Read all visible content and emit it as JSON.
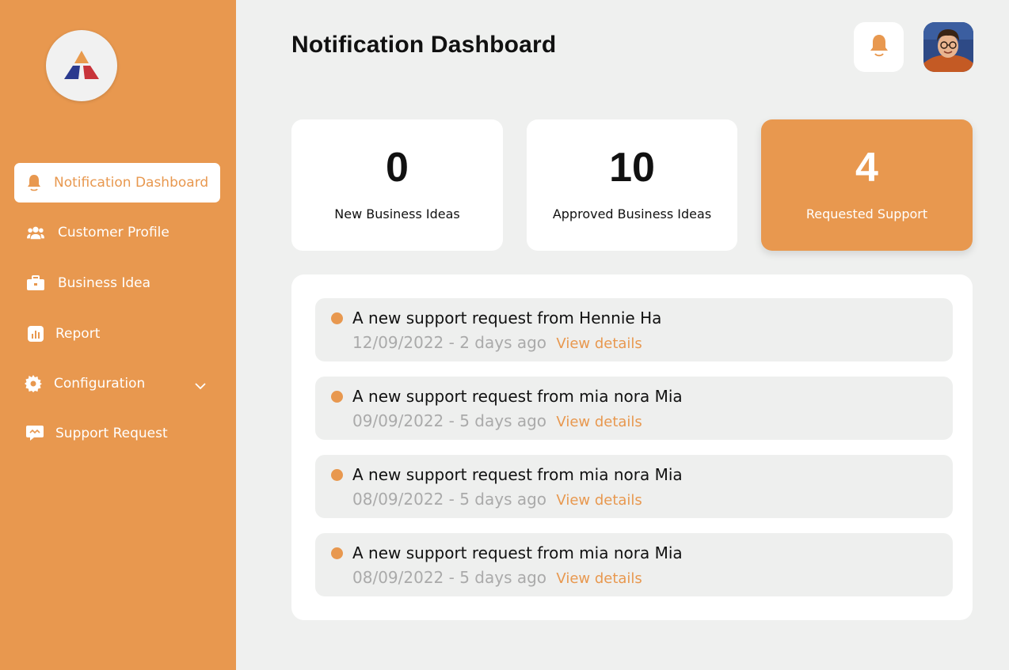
{
  "sidebar": {
    "items": [
      {
        "label": "Notification Dashboard",
        "icon": "bell-icon"
      },
      {
        "label": "Customer Profile",
        "icon": "users-icon"
      },
      {
        "label": "Business Idea",
        "icon": "briefcase-icon"
      },
      {
        "label": "Report",
        "icon": "report-icon"
      },
      {
        "label": "Configuration",
        "icon": "gear-icon"
      },
      {
        "label": "Support Request",
        "icon": "chat-icon"
      }
    ]
  },
  "header": {
    "title": "Notification Dashboard"
  },
  "stats": [
    {
      "value": "0",
      "label": "New Business Ideas"
    },
    {
      "value": "10",
      "label": "Approved Business Ideas"
    },
    {
      "value": "4",
      "label": "Requested Support"
    }
  ],
  "notifications": [
    {
      "title": "A new support request from Hennie Ha",
      "meta": "12/09/2022 - 2 days ago",
      "link": "View details"
    },
    {
      "title": "A new support request from mia nora Mia",
      "meta": "09/09/2022 - 5 days ago",
      "link": "View details"
    },
    {
      "title": "A new support request from mia nora Mia",
      "meta": "08/09/2022 - 5 days ago",
      "link": "View details"
    },
    {
      "title": "A new support request from mia nora Mia",
      "meta": "08/09/2022 - 5 days ago",
      "link": "View details"
    }
  ],
  "colors": {
    "accent": "#e8984f",
    "background": "#eff0ef",
    "card": "#ffffff",
    "muted": "#aaaaaa"
  }
}
